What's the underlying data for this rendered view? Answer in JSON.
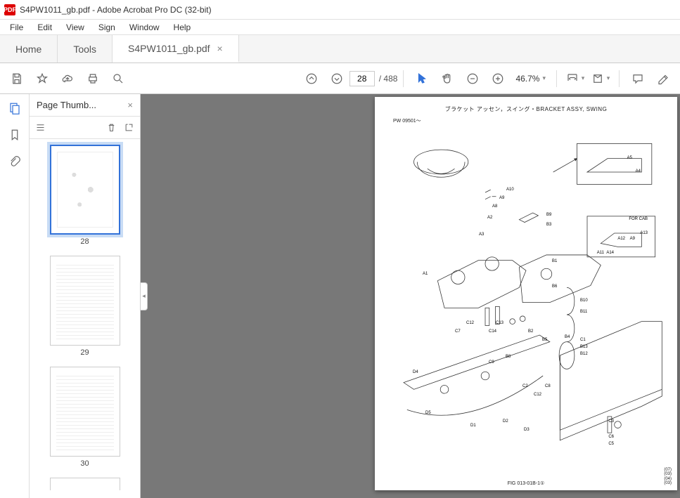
{
  "window": {
    "title": "S4PW1011_gb.pdf - Adobe Acrobat Pro DC (32-bit)",
    "icon_text": "PDF"
  },
  "menu": {
    "file": "File",
    "edit": "Edit",
    "view": "View",
    "sign": "Sign",
    "window": "Window",
    "help": "Help"
  },
  "tabs": {
    "home": "Home",
    "tools": "Tools",
    "doc": "S4PW1011_gb.pdf"
  },
  "toolbar": {
    "page_current": "28",
    "page_total": "/  488",
    "zoom": "46.7%"
  },
  "thumbs": {
    "title": "Page Thumb...",
    "pages": [
      {
        "num": "28",
        "selected": true,
        "kind": "diagram"
      },
      {
        "num": "29",
        "selected": false,
        "kind": "table"
      },
      {
        "num": "30",
        "selected": false,
        "kind": "table"
      }
    ]
  },
  "document": {
    "title_jp_en": "ブラケット アッセン，スイング・BRACKET ASSY, SWING",
    "serial": "PW 09501～",
    "for_cab": "FOR CAB",
    "fig": "FIG 013-01B-1①",
    "revs": [
      "(07)",
      "(03)",
      "(04)",
      "(03)"
    ],
    "callouts": [
      "A1",
      "A2",
      "A3",
      "A4",
      "A5",
      "A8",
      "A9",
      "A10",
      "A11",
      "A12",
      "A13",
      "A14",
      "B1",
      "B2",
      "B3",
      "B4",
      "B5",
      "B6",
      "B8",
      "B9",
      "B10",
      "B11",
      "B12",
      "B13",
      "C1",
      "C2",
      "C3",
      "C5",
      "C6",
      "C7",
      "C8",
      "C9",
      "C12",
      "C13",
      "C14",
      "C15",
      "D1",
      "D2",
      "D3",
      "D4",
      "D5"
    ]
  }
}
